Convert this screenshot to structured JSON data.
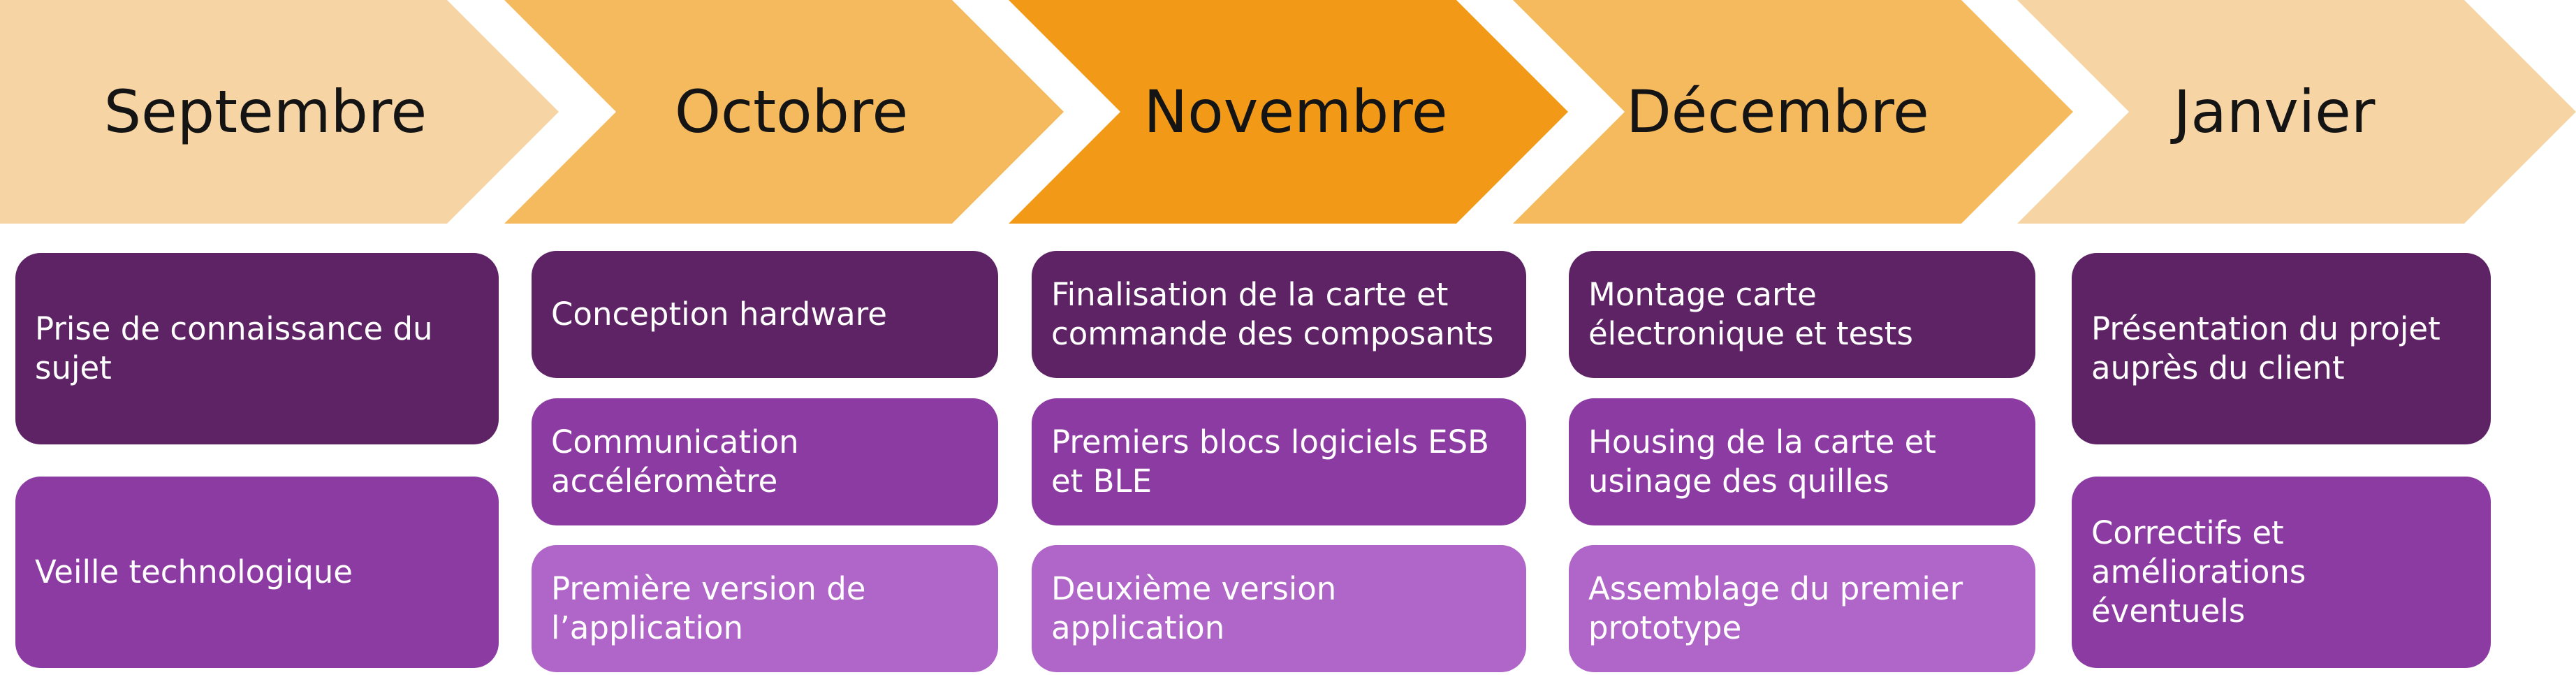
{
  "months": [
    {
      "label": "Septembre",
      "color": "#f7d4a4"
    },
    {
      "label": "Octobre",
      "color": "#f5b95e"
    },
    {
      "label": "Novembre",
      "color": "#f29a18"
    },
    {
      "label": "Décembre",
      "color": "#f5b95e"
    },
    {
      "label": "Janvier",
      "color": "#f7d4a4"
    }
  ],
  "tasks": {
    "septembre": [
      {
        "text": "Prise de connaissance du sujet"
      },
      {
        "text": "Veille technologique"
      }
    ],
    "octobre": [
      {
        "text": "Conception hardware"
      },
      {
        "text": "Communication accéléromètre"
      },
      {
        "text": "Première version de l’application"
      }
    ],
    "novembre": [
      {
        "text": "Finalisation de la carte et commande des composants"
      },
      {
        "text": "Premiers blocs logiciels ESB et BLE"
      },
      {
        "text": "Deuxième version application"
      }
    ],
    "decembre": [
      {
        "text": "Montage carte électronique et tests"
      },
      {
        "text": "Housing de la carte et usinage des quilles"
      },
      {
        "text": "Assemblage du premier prototype"
      }
    ],
    "janvier": [
      {
        "text": "Présentation du projet auprès du client"
      },
      {
        "text": "Correctifs et améliorations éventuels"
      }
    ]
  },
  "colors": {
    "task_dark": "#5e2365",
    "task_mid": "#8c3ba2",
    "task_light": "#b066c8"
  }
}
